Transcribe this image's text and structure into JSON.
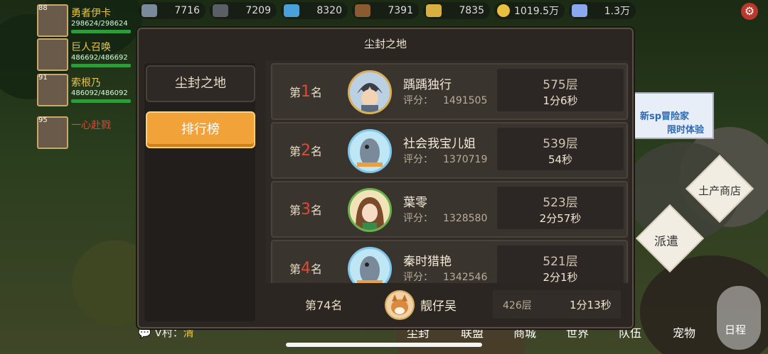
{
  "resources": [
    {
      "icon": "stone-icon",
      "value": "7716",
      "color": "#7a8a9a"
    },
    {
      "icon": "ore-icon",
      "value": "7209",
      "color": "#5a5f66"
    },
    {
      "icon": "crystal-icon",
      "value": "8320",
      "color": "#4aa0d8"
    },
    {
      "icon": "wood-icon",
      "value": "7391",
      "color": "#8a5a30"
    },
    {
      "icon": "wheat-icon",
      "value": "7835",
      "color": "#d8b040"
    },
    {
      "icon": "gold-coin-icon",
      "value": "1019.5万",
      "color": "#e8c040"
    },
    {
      "icon": "diamond-icon",
      "value": "1.3万",
      "color": "#8aa8f0"
    }
  ],
  "heroes": [
    {
      "level": "88",
      "name": "勇者伊卡",
      "hp": "298624/298624"
    },
    {
      "level": "",
      "name": "巨人召唤",
      "hp": "486692/486692"
    },
    {
      "level": "91",
      "name": "索根乃",
      "hp": "486092/486092"
    },
    {
      "level": "95",
      "name": "一心赴戮",
      "hp": ""
    }
  ],
  "side_buttons": [
    "土产商店",
    "派遣"
  ],
  "promo": {
    "line1": "新sp冒险家",
    "line2": "限时体验"
  },
  "bottom_nav": [
    "尘封",
    "联盟",
    "商城",
    "世界",
    "队伍",
    "宠物",
    "日程"
  ],
  "chat": {
    "text": "V村：",
    "highlight": "清"
  },
  "dialog": {
    "title": "尘封之地",
    "tabs": [
      {
        "label": "尘封之地",
        "active": false
      },
      {
        "label": "排行榜",
        "active": true
      }
    ],
    "score_label": "评分：",
    "entries": [
      {
        "rank_prefix": "第",
        "rank": "1",
        "rank_suffix": "名",
        "name": "踽踽独行",
        "score": "1491505",
        "floor": "575层",
        "time": "1分6秒",
        "avatar": "warrior-avatar-icon"
      },
      {
        "rank_prefix": "第",
        "rank": "2",
        "rank_suffix": "名",
        "name": "社会我宝儿姐",
        "score": "1370719",
        "floor": "539层",
        "time": "54秒",
        "avatar": "fish-avatar-icon"
      },
      {
        "rank_prefix": "第",
        "rank": "3",
        "rank_suffix": "名",
        "name": "葉零",
        "score": "1328580",
        "floor": "523层",
        "time": "2分57秒",
        "avatar": "girl-avatar-icon"
      },
      {
        "rank_prefix": "第",
        "rank": "4",
        "rank_suffix": "名",
        "name": "秦时猎艳",
        "score": "1342546",
        "floor": "521层",
        "time": "2分1秒",
        "avatar": "fish-avatar-icon"
      }
    ],
    "mine": {
      "rank": "第74名",
      "name": "靓仔吴",
      "floor": "426层",
      "time": "1分13秒",
      "avatar": "shiba-avatar-icon"
    }
  }
}
